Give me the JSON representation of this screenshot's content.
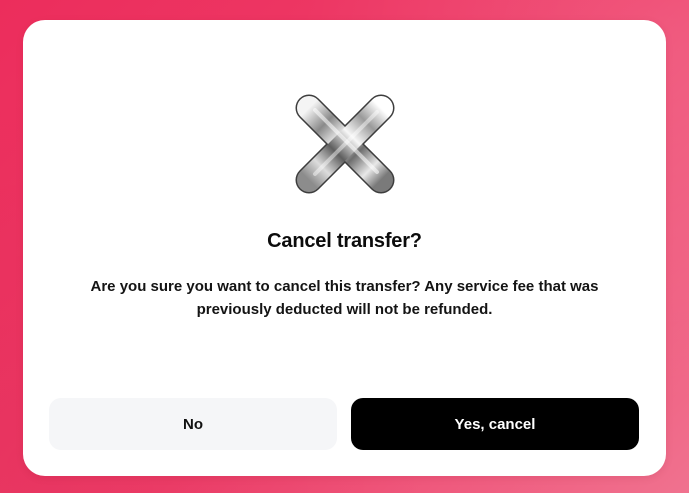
{
  "dialog": {
    "icon": "close-x-icon",
    "title": "Cancel transfer?",
    "message": "Are you sure you want to cancel this transfer? Any service fee that was previously deducted will not be refunded.",
    "buttons": {
      "no_label": "No",
      "yes_label": "Yes, cancel"
    }
  },
  "colors": {
    "backdrop": "#ec2d5c",
    "dialog_background": "#ffffff",
    "secondary_button": "#f5f6f8",
    "primary_button": "#000000",
    "primary_button_text": "#ffffff"
  }
}
